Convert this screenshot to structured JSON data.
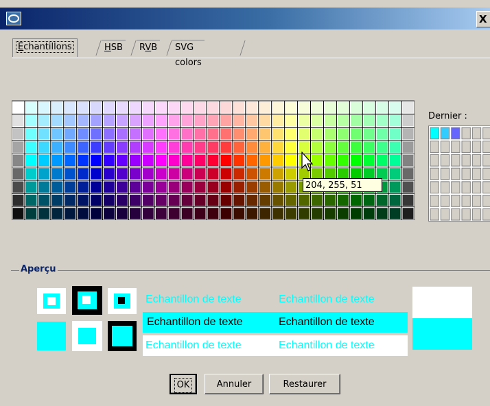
{
  "window": {
    "close_label": "X"
  },
  "tabs": [
    {
      "label": "Echantillons",
      "mnemonic_index": 0,
      "active": true
    },
    {
      "label": "HSB",
      "mnemonic_index": 0,
      "active": false
    },
    {
      "label": "RVB",
      "mnemonic_index": 1,
      "active": false
    },
    {
      "label": "SVG colors",
      "active": false
    }
  ],
  "swatches": {
    "tooltip": "204, 255, 51",
    "recent_label": "Dernier :",
    "recent_colors": [
      "#00ffff",
      "#33ccff",
      "#6666ff"
    ]
  },
  "apercu": {
    "title": "Aperçu",
    "sample_text": "Echantillon de texte",
    "foreground": "#00ffff"
  },
  "buttons": {
    "ok": "OK",
    "cancel": "Annuler",
    "restore": "Restaurer"
  }
}
